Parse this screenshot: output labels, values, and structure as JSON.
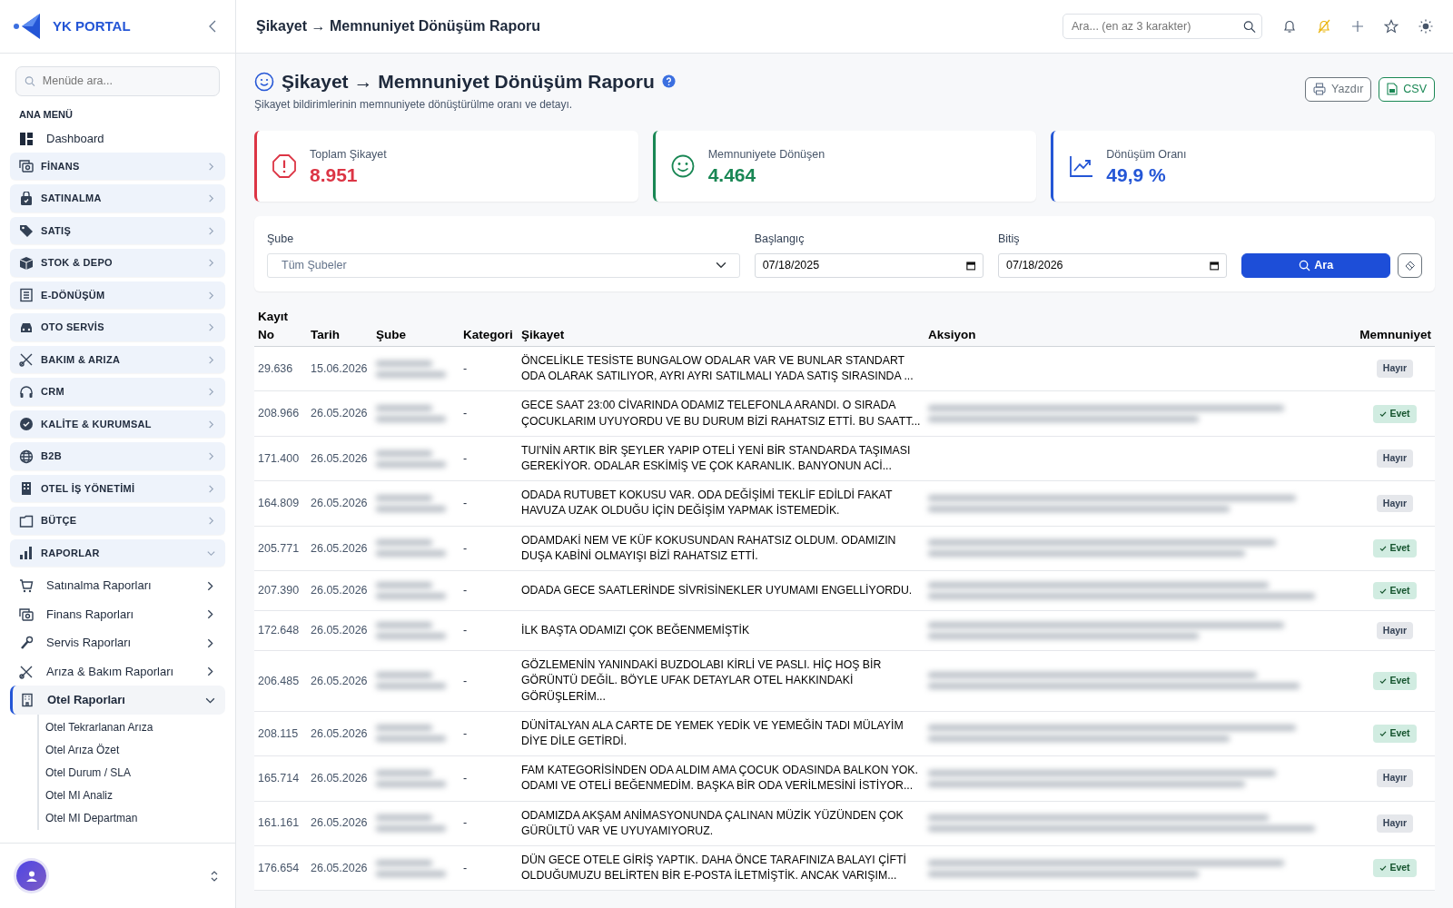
{
  "sidebar": {
    "brand": "YK PORTAL",
    "search": {
      "placeholder": "Menüde ara..."
    },
    "section_title": "ANA MENÜ",
    "items": [
      {
        "kind": "link",
        "label": "Dashboard"
      },
      {
        "kind": "group",
        "label": "FİNANS",
        "expanded": false
      },
      {
        "kind": "group",
        "label": "SATINALMA",
        "expanded": false
      },
      {
        "kind": "group",
        "label": "SATIŞ",
        "expanded": false
      },
      {
        "kind": "group",
        "label": "STOK & DEPO",
        "expanded": false
      },
      {
        "kind": "group",
        "label": "E-DÖNÜŞÜM",
        "expanded": false
      },
      {
        "kind": "group",
        "label": "OTO SERVİS",
        "expanded": false
      },
      {
        "kind": "group",
        "label": "BAKIM & ARIZA",
        "expanded": false
      },
      {
        "kind": "group",
        "label": "CRM",
        "expanded": false
      },
      {
        "kind": "group",
        "label": "KALİTE & KURUMSAL",
        "expanded": false
      },
      {
        "kind": "group",
        "label": "B2B",
        "expanded": false
      },
      {
        "kind": "group",
        "label": "OTEL İŞ YÖNETİMİ",
        "expanded": false
      },
      {
        "kind": "group",
        "label": "BÜTÇE",
        "expanded": false
      },
      {
        "kind": "group",
        "label": "RAPORLAR",
        "expanded": true,
        "children": [
          {
            "label": "Satınalma Raporları",
            "expanded": false,
            "selected": false
          },
          {
            "label": "Finans Raporları",
            "expanded": false,
            "selected": false
          },
          {
            "label": "Servis Raporları",
            "expanded": false,
            "selected": false
          },
          {
            "label": "Arıza & Bakım Raporları",
            "expanded": false,
            "selected": false
          },
          {
            "label": "Otel Raporları",
            "expanded": true,
            "selected": true,
            "children": [
              {
                "label": "Otel Tekrarlanan Arıza"
              },
              {
                "label": "Otel Arıza Özet"
              },
              {
                "label": "Otel Durum / SLA"
              },
              {
                "label": "Otel MI Analiz"
              },
              {
                "label": "Otel MI Departman"
              }
            ]
          }
        ]
      }
    ]
  },
  "topbar": {
    "title": "Şikayet → Memnuniyet Dönüşüm Raporu",
    "search": {
      "placeholder": "Ara... (en az 3 karakter)"
    }
  },
  "page": {
    "title": "Şikayet → Memnuniyet Dönüşüm Raporu",
    "subtitle": "Şikayet bildirimlerinin memnuniyete dönüştürülme oranı ve detayı.",
    "buttons": [
      {
        "kind": "print",
        "label": "Yazdır"
      },
      {
        "kind": "csv",
        "label": "CSV"
      }
    ]
  },
  "stats": [
    {
      "kind": "danger",
      "label": "Toplam Şikayet",
      "value": "8.951"
    },
    {
      "kind": "success",
      "label": "Memnuniyete Dönüşen",
      "value": "4.464"
    },
    {
      "kind": "primary",
      "label": "Dönüşüm Oranı",
      "value": "49,9 %"
    }
  ],
  "filters": {
    "branch": {
      "label": "Şube",
      "value": "Tüm Şubeler"
    },
    "start": {
      "label": "Başlangıç",
      "value": "07/18/2025"
    },
    "end": {
      "label": "Bitiş",
      "value": "07/18/2026"
    },
    "search_button": "Ara"
  },
  "table": {
    "columns": [
      {
        "lines": [
          "Kayıt",
          "No"
        ]
      },
      {
        "lines": [
          "Tarih"
        ]
      },
      {
        "lines": [
          "Şube"
        ]
      },
      {
        "lines": [
          "Kategori"
        ]
      },
      {
        "lines": [
          "Şikayet"
        ]
      },
      {
        "lines": [
          "Aksiyon"
        ]
      },
      {
        "lines": [
          "Memnuniyet"
        ]
      }
    ],
    "rows": [
      {
        "no": "29.636",
        "date": "15.06.2026",
        "branch_blurred": true,
        "category": "-",
        "complaint": "ÖNCELİKLE TESİSTE BUNGALOW ODALAR VAR VE BUNLAR STANDART ODA OLARAK SATILIYOR, AYRI AYRI SATILMALI YADA SATIŞ SIRASINDA ...",
        "action_blurred": false,
        "satisfied": false,
        "satisfaction": "Hayır"
      },
      {
        "no": "208.966",
        "date": "26.05.2026",
        "branch_blurred": true,
        "category": "-",
        "complaint": "GECE SAAT 23:00 CİVARINDA ODAMIZ TELEFONLA ARANDI. O SIRADA ÇOCUKLARIM UYUYORDU VE BU DURUM BİZİ RAHATSIZ ETTİ. BU SAATT...",
        "action_blurred": true,
        "satisfied": true,
        "satisfaction": "Evet"
      },
      {
        "no": "171.400",
        "date": "26.05.2026",
        "branch_blurred": true,
        "category": "-",
        "complaint": "TUI'NİN ARTIK BİR ŞEYLER YAPIP OTELİ YENİ BİR STANDARDA TAŞIMASI GEREKİYOR. ODALAR ESKİMİŞ VE ÇOK KARANLIK. BANYONUN ACİ...",
        "action_blurred": false,
        "satisfied": false,
        "satisfaction": "Hayır"
      },
      {
        "no": "164.809",
        "date": "26.05.2026",
        "branch_blurred": true,
        "category": "-",
        "complaint": "ODADA RUTUBET KOKUSU VAR. ODA DEĞİŞİMİ TEKLİF EDİLDİ FAKAT HAVUZA UZAK OLDUĞU İÇİN DEĞİŞİM YAPMAK İSTEMEDİK.",
        "action_blurred": true,
        "satisfied": false,
        "satisfaction": "Hayır"
      },
      {
        "no": "205.771",
        "date": "26.05.2026",
        "branch_blurred": true,
        "category": "-",
        "complaint": "ODAMDAKİ NEM VE KÜF KOKUSUNDAN RAHATSIZ OLDUM. ODAMIZIN DUŞA KABİNİ OLMAYIŞI BİZİ RAHATSIZ ETTİ.",
        "action_blurred": true,
        "satisfied": true,
        "satisfaction": "Evet"
      },
      {
        "no": "207.390",
        "date": "26.05.2026",
        "branch_blurred": true,
        "category": "-",
        "complaint": "ODADA GECE SAATLERİNDE SİVRİSİNEKLER UYUMAMI ENGELLİYORDU.",
        "action_blurred": true,
        "satisfied": true,
        "satisfaction": "Evet"
      },
      {
        "no": "172.648",
        "date": "26.05.2026",
        "branch_blurred": true,
        "category": "-",
        "complaint": "İLK BAŞTA ODAMIZI ÇOK BEĞENMEMİŞTİK",
        "action_blurred": true,
        "satisfied": false,
        "satisfaction": "Hayır"
      },
      {
        "no": "206.485",
        "date": "26.05.2026",
        "branch_blurred": true,
        "category": "-",
        "complaint": "GÖZLEMENİN YANINDAKİ BUZDOLABI KİRLİ VE PASLI. HİÇ HOŞ BİR GÖRÜNTÜ DEĞİL. BÖYLE UFAK DETAYLAR OTEL HAKKINDAKİ GÖRÜŞLERİM...",
        "action_blurred": true,
        "satisfied": true,
        "satisfaction": "Evet"
      },
      {
        "no": "208.115",
        "date": "26.05.2026",
        "branch_blurred": true,
        "category": "-",
        "complaint": "DÜNİTALYAN ALA CARTE DE YEMEK YEDİK VE YEMEĞİN TADI MÜLAYİM DİYE DİLE GETİRDİ.",
        "action_blurred": true,
        "satisfied": true,
        "satisfaction": "Evet"
      },
      {
        "no": "165.714",
        "date": "26.05.2026",
        "branch_blurred": true,
        "category": "-",
        "complaint": "FAM KATEGORİSİNDEN ODA ALDIM AMA ÇOCUK ODASINDA BALKON YOK. ODAMI VE OTELİ BEĞENMEDİM. BAŞKA BİR ODA VERİLMESİNİ İSTİYOR...",
        "action_blurred": true,
        "satisfied": false,
        "satisfaction": "Hayır"
      },
      {
        "no": "161.161",
        "date": "26.05.2026",
        "branch_blurred": true,
        "category": "-",
        "complaint": "ODAMIZDA AKŞAM ANİMASYONUNDA ÇALINAN MÜZİK YÜZÜNDEN ÇOK GÜRÜLTÜ VAR VE UYUYAMIYORUZ.",
        "action_blurred": true,
        "satisfied": false,
        "satisfaction": "Hayır"
      },
      {
        "no": "176.654",
        "date": "26.05.2026",
        "branch_blurred": true,
        "category": "-",
        "complaint": "DÜN GECE OTELE GİRİŞ YAPTIK. DAHA ÖNCE TARAFINIZA BALAYI ÇİFTİ OLDUĞUMUZU BELİRTEN BİR E-POSTA İLETMİŞTİK. ANCAK VARIŞIM...",
        "action_blurred": true,
        "satisfied": true,
        "satisfaction": "Evet"
      }
    ]
  }
}
